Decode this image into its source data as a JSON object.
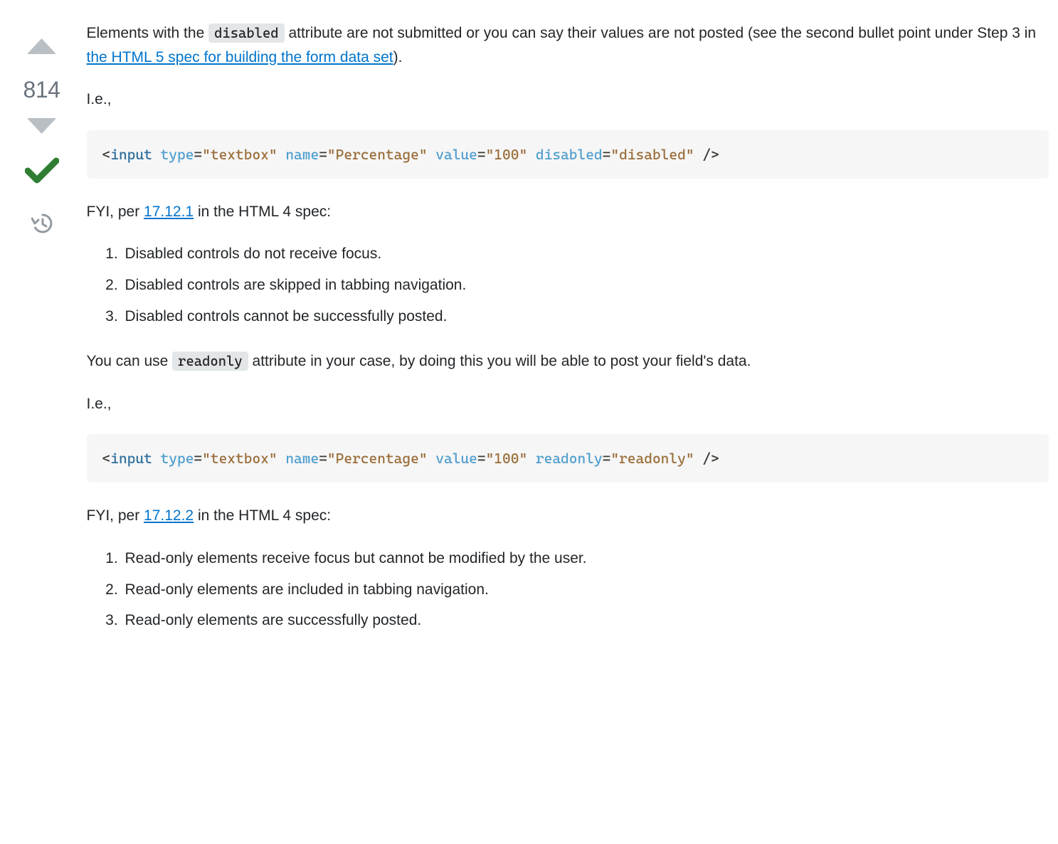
{
  "vote": {
    "score": "814"
  },
  "p1": {
    "t1": "Elements with the ",
    "code": "disabled",
    "t2": " attribute are not submitted or you can say their values are not posted (see the second bullet point under Step 3 in ",
    "link": "the HTML 5 spec for building the form data set",
    "t3": ")."
  },
  "p_ie_1": "I.e.,",
  "code1": {
    "open_lt": "<",
    "tag": "input",
    "a1": "type",
    "eq": "=",
    "v1": "\"textbox\"",
    "a2": "name",
    "v2": "\"Percentage\"",
    "a3": "value",
    "v3": "\"100\"",
    "a4": "disabled",
    "v4": "\"disabled\"",
    "close": "/>"
  },
  "p2": {
    "t1": "FYI, per ",
    "link": "17.12.1",
    "t2": " in the HTML 4 spec:"
  },
  "list1": {
    "i1": "Disabled controls do not receive focus.",
    "i2": "Disabled controls are skipped in tabbing navigation.",
    "i3": "Disabled controls cannot be successfully posted."
  },
  "p3": {
    "t1": "You can use ",
    "code": "readonly",
    "t2": " attribute in your case, by doing this you will be able to post your field's data."
  },
  "p_ie_2": "I.e.,",
  "code2": {
    "open_lt": "<",
    "tag": "input",
    "a1": "type",
    "eq": "=",
    "v1": "\"textbox\"",
    "a2": "name",
    "v2": "\"Percentage\"",
    "a3": "value",
    "v3": "\"100\"",
    "a4": "readonly",
    "v4": "\"readonly\"",
    "close": "/>"
  },
  "p4": {
    "t1": "FYI, per ",
    "link": "17.12.2",
    "t2": " in the HTML 4 spec:"
  },
  "list2": {
    "i1": "Read-only elements receive focus but cannot be modified by the user.",
    "i2": "Read-only elements are included in tabbing navigation.",
    "i3": "Read-only elements are successfully posted."
  }
}
